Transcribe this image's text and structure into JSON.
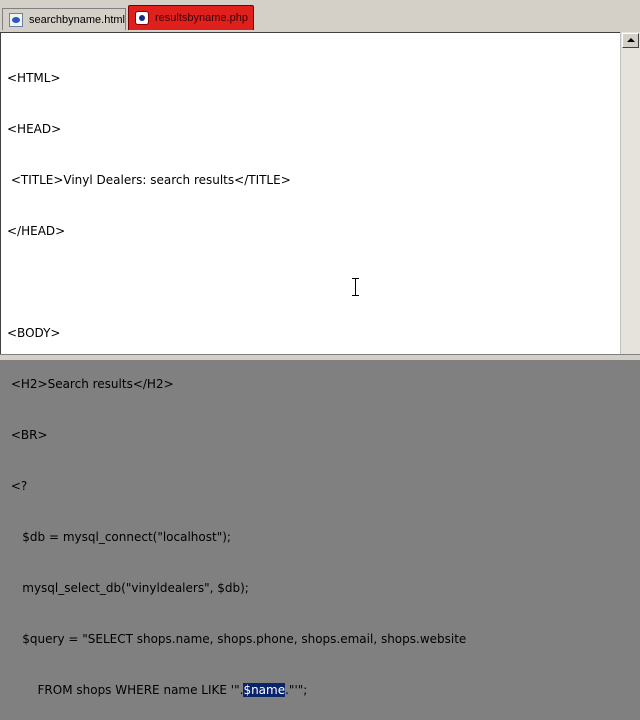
{
  "tabs": [
    {
      "label": "searchbyname.html",
      "icon": "html-file-icon",
      "active": false
    },
    {
      "label": "resultsbyname.php",
      "icon": "php-file-icon",
      "active": true
    }
  ],
  "colors": {
    "active_tab": "#e0201c",
    "selection": "#0a246a"
  },
  "code": {
    "l1": "<HTML>",
    "l2": "<HEAD>",
    "l3": " <TITLE>Vinyl Dealers: search results</TITLE>",
    "l4": "</HEAD>",
    "l5": "",
    "l6": "<BODY>",
    "l7": " <H2>Search results</H2>",
    "l8": " <BR>",
    "l9": " <?",
    "l10": "\t$db = mysql_connect(\"localhost\");",
    "l11": "\tmysql_select_db(\"vinyldealers\", $db);",
    "l12": "\t$query = \"SELECT shops.name, shops.phone, shops.email, shops.website",
    "l13_before": "\t\tFROM shops WHERE name LIKE '\".",
    "l13_selected": "$name",
    "l13_after": ".\"'\";"
  }
}
